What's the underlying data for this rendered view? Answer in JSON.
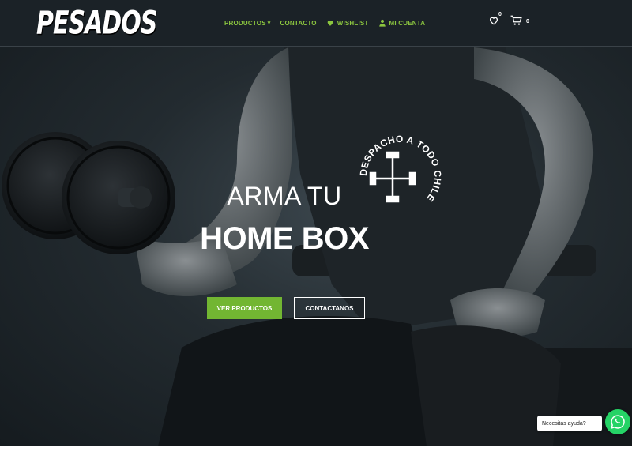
{
  "header": {
    "logo_text": "PESADOS",
    "nav": [
      {
        "label": "PRODUCTOS",
        "icon": "chevron-down-icon"
      },
      {
        "label": "CONTACTO"
      },
      {
        "label": "WISHLIST",
        "icon": "heart-icon"
      },
      {
        "label": "MI CUENTA",
        "icon": "user-icon"
      }
    ],
    "wishlist_count": "0",
    "cart_count": "0"
  },
  "hero": {
    "line1": "ARMA TU",
    "line2": "HOME BOX",
    "primary_button": "VER PRODUCTOS",
    "secondary_button": "CONTACTANOS",
    "stamp_text": "DESPACHO A TODO CHILE"
  },
  "chat": {
    "bubble_text": "Necesitas ayuda?",
    "icon": "whatsapp-icon"
  },
  "colors": {
    "header_bg": "#1b2227",
    "accent": "#8cc63f",
    "button_green": "#72b632",
    "whatsapp": "#25d366"
  }
}
